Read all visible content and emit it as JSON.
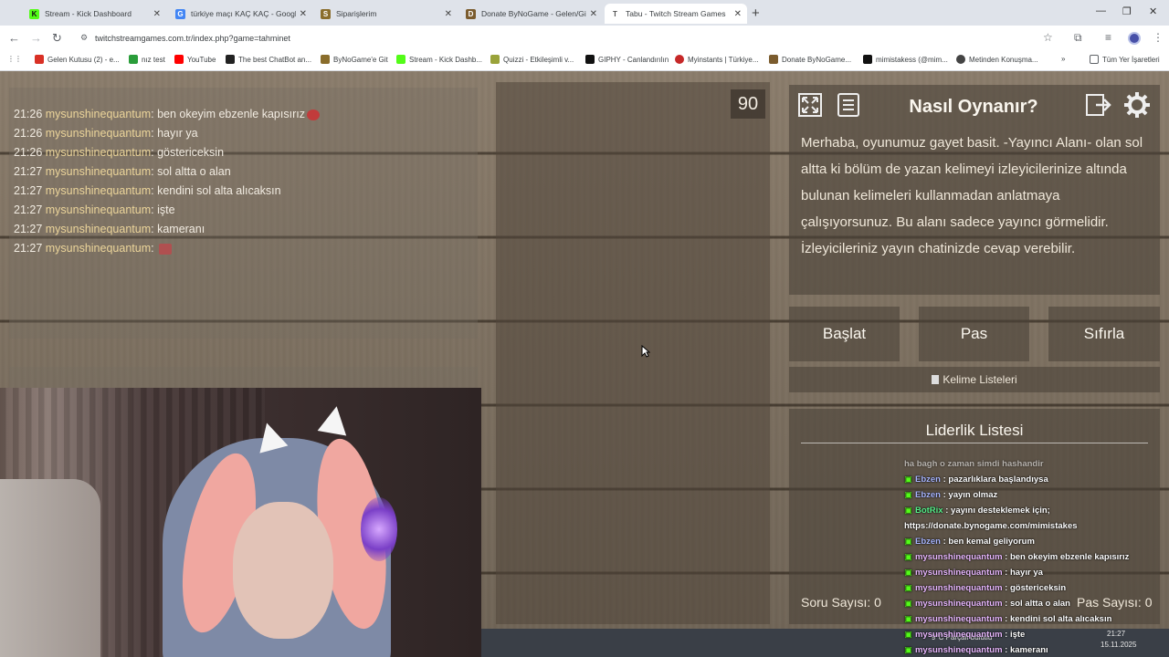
{
  "browser": {
    "tabs": [
      {
        "title": "Stream - Kick Dashboard",
        "color": "#53fc18",
        "fav": "K"
      },
      {
        "title": "türkiye maçı KAÇ KAÇ - Google'da Ara",
        "color": "#4285f4",
        "fav": "G"
      },
      {
        "title": "Siparişlerim",
        "color": "#8a6d2b",
        "fav": "S"
      },
      {
        "title": "Donate ByNoGame - Gelen/Giden...",
        "color": "#7b5c2e",
        "fav": "D"
      },
      {
        "title": "Tabu - Twitch Stream Games",
        "color": "#6b6b6b",
        "fav": "T"
      }
    ],
    "url": "twitchstreamgames.com.tr/index.php?game=tahminet",
    "bookmarks": [
      {
        "label": "Gelen Kutusu (2) - e...",
        "color": "#d93025"
      },
      {
        "label": "nız test",
        "color": "#2a9d3a"
      },
      {
        "label": "YouTube",
        "color": "#ff0000"
      },
      {
        "label": "The best ChatBot an...",
        "color": "#222222"
      },
      {
        "label": "ByNoGame'e Git",
        "color": "#8a6d2b"
      },
      {
        "label": "Stream - Kick Dashb...",
        "color": "#53fc18"
      },
      {
        "label": "Quizzi - Etkileşimli v...",
        "color": "#9aa33a"
      },
      {
        "label": "GIPHY - Canlandırılın",
        "color": "#111111"
      },
      {
        "label": "Myinstants | Türkiye...",
        "color": "#c62828"
      },
      {
        "label": "Donate ByNoGame...",
        "color": "#7b5c2e"
      },
      {
        "label": "mimistakess (@mim...",
        "color": "#111111"
      },
      {
        "label": "Metinden Konuşma...",
        "color": "#444444"
      },
      {
        "label": "Tüm Yer İşaretleri",
        "color": "#5f6368"
      }
    ]
  },
  "chat": [
    {
      "time": "21:26",
      "user": "mysunshinequantum",
      "msg": "ben okeyim ebzenle kapısırız",
      "emote": true
    },
    {
      "time": "21:26",
      "user": "mysunshinequantum",
      "msg": "hayır ya",
      "emote": false
    },
    {
      "time": "21:26",
      "user": "mysunshinequantum",
      "msg": "göstericeksin",
      "emote": false
    },
    {
      "time": "21:27",
      "user": "mysunshinequantum",
      "msg": "sol altta o alan",
      "emote": false
    },
    {
      "time": "21:27",
      "user": "mysunshinequantum",
      "msg": "kendini sol alta alıcaksın",
      "emote": false
    },
    {
      "time": "21:27",
      "user": "mysunshinequantum",
      "msg": "işte",
      "emote": false
    },
    {
      "time": "21:27",
      "user": "mysunshinequantum",
      "msg": "kameranı",
      "emote": false
    },
    {
      "time": "21:27",
      "user": "mysunshinequantum",
      "msg": "",
      "emote": true
    }
  ],
  "timer": "90",
  "how": {
    "title": "Nasıl Oynanır?",
    "text": "Merhaba, oyunumuz gayet basit. -Yayıncı Alanı- olan sol altta ki bölüm de yazan kelimeyi izleyicilerinize altında bulunan kelimeleri kullanmadan anlatmaya çalışıyorsunuz. Bu alanı sadece yayıncı görmelidir. İzleyicileriniz yayın chatinizde cevap verebilir."
  },
  "buttons": {
    "start": "Başlat",
    "pass": "Pas",
    "reset": "Sıfırla",
    "word_lists": "Kelime Listeleri"
  },
  "leaderboard": {
    "title": "Liderlik Listesi"
  },
  "stats": {
    "questions": "Soru Sayısı: 0",
    "passes": "Pas Sayısı: 0"
  },
  "overlay": [
    {
      "user": "",
      "msg": "ha bagh o zaman simdi hashandir",
      "kind": "partial"
    },
    {
      "user": "Ebzen",
      "msg": ": pazarlıklara başlandıysa",
      "kind": "e"
    },
    {
      "user": "Ebzen",
      "msg": ": yayın olmaz",
      "kind": "e"
    },
    {
      "user": "BotRix",
      "msg": ": yayını desteklemek için;",
      "kind": "b"
    },
    {
      "user": "",
      "msg": "https://donate.bynogame.com/mimistakes",
      "kind": "link"
    },
    {
      "user": "Ebzen",
      "msg": ": ben kemal geliyorum",
      "kind": "e"
    },
    {
      "user": "mysunshinequantum",
      "msg": ": ben okeyim ebzenle kapısırız",
      "kind": "m"
    },
    {
      "user": "mysunshinequantum",
      "msg": ": hayır ya",
      "kind": "m"
    },
    {
      "user": "mysunshinequantum",
      "msg": ": göstericeksin",
      "kind": "m"
    },
    {
      "user": "mysunshinequantum",
      "msg": ": sol altta o alan",
      "kind": "m"
    },
    {
      "user": "mysunshinequantum",
      "msg": ": kendini sol alta alıcaksın",
      "kind": "m"
    },
    {
      "user": "mysunshinequantum",
      "msg": ": işte",
      "kind": "m"
    },
    {
      "user": "mysunshinequantum",
      "msg": ": kameranı",
      "kind": "m"
    }
  ],
  "tray": {
    "weather": "9°C  Parçalı bulutlu",
    "time": "21:27",
    "date": "15.11.2025"
  }
}
